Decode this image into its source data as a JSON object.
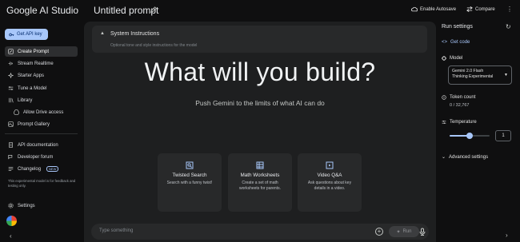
{
  "brand": "Google AI Studio",
  "sidebar": {
    "api_key_label": "Get API key",
    "items": [
      {
        "label": "Create Prompt",
        "icon": "edit-square-icon"
      },
      {
        "label": "Stream Realtime",
        "icon": "stream-icon"
      },
      {
        "label": "Starter Apps",
        "icon": "sparkle-icon"
      },
      {
        "label": "Tune a Model",
        "icon": "tune-icon"
      },
      {
        "label": "Library",
        "icon": "library-icon"
      },
      {
        "label": "Allow Drive access",
        "icon": "drive-icon"
      },
      {
        "label": "Prompt Gallery",
        "icon": "gallery-icon"
      }
    ],
    "bottom_items": [
      {
        "label": "API documentation",
        "icon": "docs-icon"
      },
      {
        "label": "Developer forum",
        "icon": "forum-icon"
      },
      {
        "label": "Changelog",
        "icon": "changelog-icon",
        "badge": "NEW"
      }
    ],
    "note": "This experimental model is for feedback and testing only.",
    "settings_label": "Settings"
  },
  "header": {
    "title": "Untitled prompt",
    "autosave_label": "Enable Autosave",
    "compare_label": "Compare"
  },
  "main": {
    "system_instructions_title": "System Instructions",
    "system_instructions_placeholder": "Optional tone and style instructions for the model",
    "hero": "What will you build?",
    "subtitle": "Push Gemini to the limits of what AI can do",
    "cards": [
      {
        "title": "Twisted Search",
        "desc": "Search with a funny twist!",
        "icon": "search-frame-icon"
      },
      {
        "title": "Math Worksheets",
        "desc": "Create a set of math worksheets for parents.",
        "icon": "grid-table-icon"
      },
      {
        "title": "Video Q&A",
        "desc": "Ask questions about key details in a video.",
        "icon": "video-icon"
      }
    ],
    "input_placeholder": "Type something",
    "run_label": "Run"
  },
  "run_settings": {
    "title": "Run settings",
    "get_code_label": "Get code",
    "model_label": "Model",
    "model_value_line1": "Gemini 2.0 Flash",
    "model_value_line2": "Thinking Experimental",
    "token_label": "Token count",
    "token_value": "0 / 32,767",
    "temperature_label": "Temperature",
    "temperature_value": "1",
    "temperature_fraction": 0.5,
    "advanced_label": "Advanced settings"
  },
  "colors": {
    "accent": "#a8c7fa",
    "panel": "#1e1f20",
    "background": "#0f0f10"
  }
}
